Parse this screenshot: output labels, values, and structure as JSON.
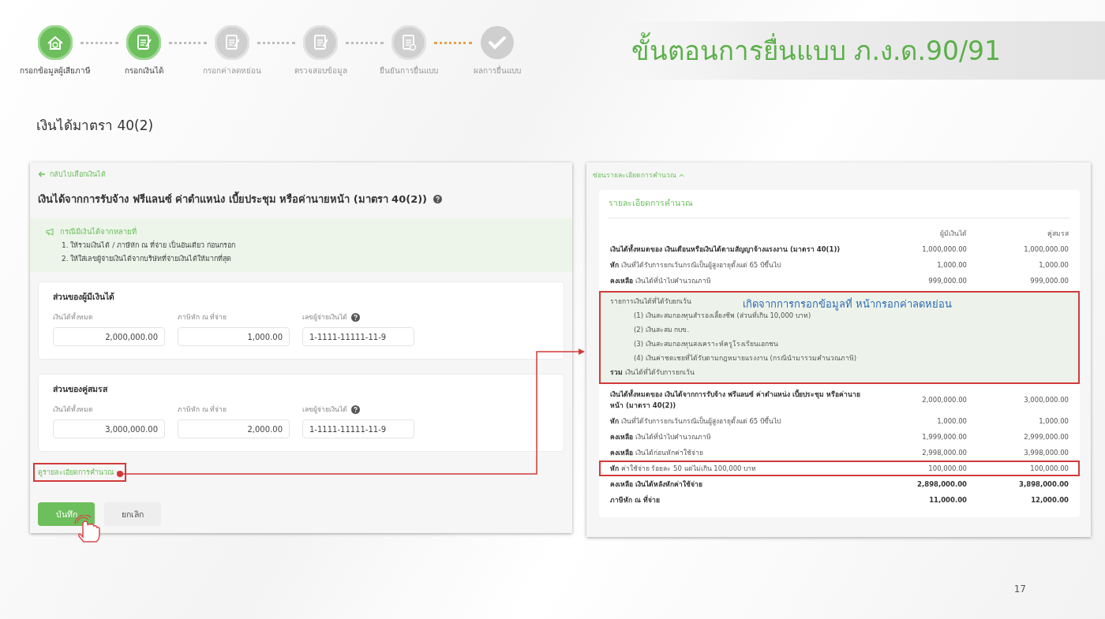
{
  "stepper": {
    "steps": [
      {
        "label": "กรอกข้อมูลผู้เสียภาษี",
        "completed": true
      },
      {
        "label": "กรอกเงินได้",
        "completed": true
      },
      {
        "label": "กรอกค่าลดหย่อน",
        "completed": false
      },
      {
        "label": "ตรวจสอบข้อมูล",
        "completed": false
      },
      {
        "label": "ยืนยันการยื่นแบบ",
        "completed": false
      },
      {
        "label": "ผลการยื่นแบบ",
        "completed": false
      }
    ],
    "connectors": [
      {
        "highlighted": false
      },
      {
        "highlighted": false
      },
      {
        "highlighted": false
      },
      {
        "highlighted": false
      },
      {
        "highlighted": true
      }
    ]
  },
  "slide_title": "ขั้นตอนการยื่นแบบ ภ.ง.ด.90/91",
  "section_title": "เงินได้มาตรา 40(2)",
  "form": {
    "back_link": "กลับไปเลือกเงินได้",
    "heading": "เงินได้จากการรับจ้าง ฟรีแลนซ์ ค่าตำแหน่ง เบี้ยประชุม หรือค่านายหน้า (มาตรา 40(2))",
    "info": {
      "title": "กรณีมีเงินได้จากหลายที่",
      "lines": [
        "1. ให้รวมเงินได้ / ภาษีหัก ณ ที่จ่าย เป็นอันเดียว ก่อนกรอก",
        "2. ให้ใส่เลขผู้จ่ายเงินได้จากบริษัทที่จ่ายเงินได้ให้มากที่สุด"
      ]
    },
    "sections": [
      {
        "title": "ส่วนของผู้มีเงินได้",
        "fields": [
          {
            "label": "เงินได้ทั้งหมด",
            "value": "2,000,000.00",
            "help": false,
            "numeric": true
          },
          {
            "label": "ภาษีหัก ณ ที่จ่าย",
            "value": "1,000.00",
            "help": false,
            "numeric": true
          },
          {
            "label": "เลขผู้จ่ายเงินได้",
            "value": "1-1111-11111-11-9",
            "help": true,
            "numeric": false
          }
        ]
      },
      {
        "title": "ส่วนของคู่สมรส",
        "fields": [
          {
            "label": "เงินได้ทั้งหมด",
            "value": "3,000,000.00",
            "help": false,
            "numeric": true
          },
          {
            "label": "ภาษีหัก ณ ที่จ่าย",
            "value": "2,000.00",
            "help": false,
            "numeric": true
          },
          {
            "label": "เลขผู้จ่ายเงินได้",
            "value": "1-1111-11111-11-9",
            "help": true,
            "numeric": false
          }
        ]
      }
    ],
    "detail_link": {
      "label": "ดูรายละเอียดการคำนวณ",
      "highlighted": true
    },
    "buttons": [
      {
        "label": "บันทึก",
        "primary": true
      },
      {
        "label": "ยกเลิก",
        "primary": false
      }
    ]
  },
  "calculation": {
    "hide_link": "ซ่อนรายละเอียดการคำนวณ",
    "title": "รายละเอียดการคำนวณ",
    "columns": [
      "ผู้มีเงินได้",
      "คู่สมรส"
    ],
    "rows": [
      {
        "kind": "row",
        "label": "เงินได้ทั้งหมดของ เงินเดือนหรือเงินได้ตามสัญญาจ้างแรงงาน (มาตรา 40(1))",
        "label_bold": true,
        "values_bold": false,
        "highlighted": false,
        "values": [
          "1,000,000.00",
          "1,000,000.00"
        ]
      },
      {
        "kind": "row",
        "label": "**หัก** เงินที่ได้รับการยกเว้นกรณีเป็นผู้สูงอายุตั้งแต่ 65 ปีขึ้นไป",
        "label_bold": false,
        "values_bold": false,
        "highlighted": false,
        "values": [
          "1,000.00",
          "1,000.00"
        ]
      },
      {
        "kind": "row",
        "label": "**คงเหลือ** เงินได้ที่นำไปคำนวณภาษี",
        "label_bold": false,
        "values_bold": false,
        "highlighted": false,
        "values": [
          "999,000.00",
          "999,000.00"
        ]
      },
      {
        "kind": "exempt",
        "heading": "รายการเงินได้ที่ได้รับยกเว้น",
        "note": "เกิดจากการกรอกข้อมูลที่ หน้ากรอกค่าลดหย่อน",
        "highlighted": true,
        "items": [
          "(1) เงินสะสมกองทุนสำรองเลี้ยงชีพ (ส่วนที่เกิน 10,000 บาท)",
          "(2) เงินสะสม กบข.",
          "(3) เงินสะสมกองทุนสงเคราะห์ครูโรงเรียนเอกชน",
          "(4) เงินค่าชดเชยที่ได้รับตามกฎหมายแรงงาน (กรณีนำมารวมคำนวณภาษี)"
        ],
        "total": "**รวม** เงินได้ที่ได้รับการยกเว้น"
      },
      {
        "kind": "row",
        "label": "เงินได้ทั้งหมดของ เงินได้จากการรับจ้าง ฟรีแลนซ์ ค่าตำแหน่ง เบี้ยประชุม หรือค่านายหน้า (มาตรา 40(2))",
        "label_bold": true,
        "values_bold": false,
        "highlighted": false,
        "values": [
          "2,000,000.00",
          "3,000,000.00"
        ]
      },
      {
        "kind": "row",
        "label": "**หัก** เงินที่ได้รับการยกเว้นกรณีเป็นผู้สูงอายุตั้งแต่ 65 ปีขึ้นไป",
        "label_bold": false,
        "values_bold": false,
        "highlighted": false,
        "values": [
          "1,000.00",
          "1,000.00"
        ]
      },
      {
        "kind": "row",
        "label": "**คงเหลือ** เงินได้ที่นำไปคำนวณภาษี",
        "label_bold": false,
        "values_bold": false,
        "highlighted": false,
        "values": [
          "1,999,000.00",
          "2,999,000.00"
        ]
      },
      {
        "kind": "row",
        "label": "**คงเหลือ** เงินได้ก่อนหักค่าใช้จ่าย",
        "label_bold": false,
        "values_bold": false,
        "highlighted": false,
        "values": [
          "2,998,000.00",
          "3,998,000.00"
        ]
      },
      {
        "kind": "row",
        "label": "**หัก** ค่าใช้จ่าย ร้อยละ 50 แต่ไม่เกิน 100,000 บาท",
        "label_bold": false,
        "values_bold": false,
        "highlighted": true,
        "values": [
          "100,000.00",
          "100,000.00"
        ]
      },
      {
        "kind": "row",
        "label": "คงเหลือ เงินได้หลังหักค่าใช้จ่าย",
        "label_bold": true,
        "values_bold": true,
        "highlighted": false,
        "values": [
          "2,898,000.00",
          "3,898,000.00"
        ]
      },
      {
        "kind": "row",
        "label": "ภาษีหัก ณ ที่จ่าย",
        "label_bold": true,
        "values_bold": true,
        "highlighted": false,
        "values": [
          "11,000.00",
          "12,000.00"
        ]
      }
    ]
  },
  "page_number": "17"
}
